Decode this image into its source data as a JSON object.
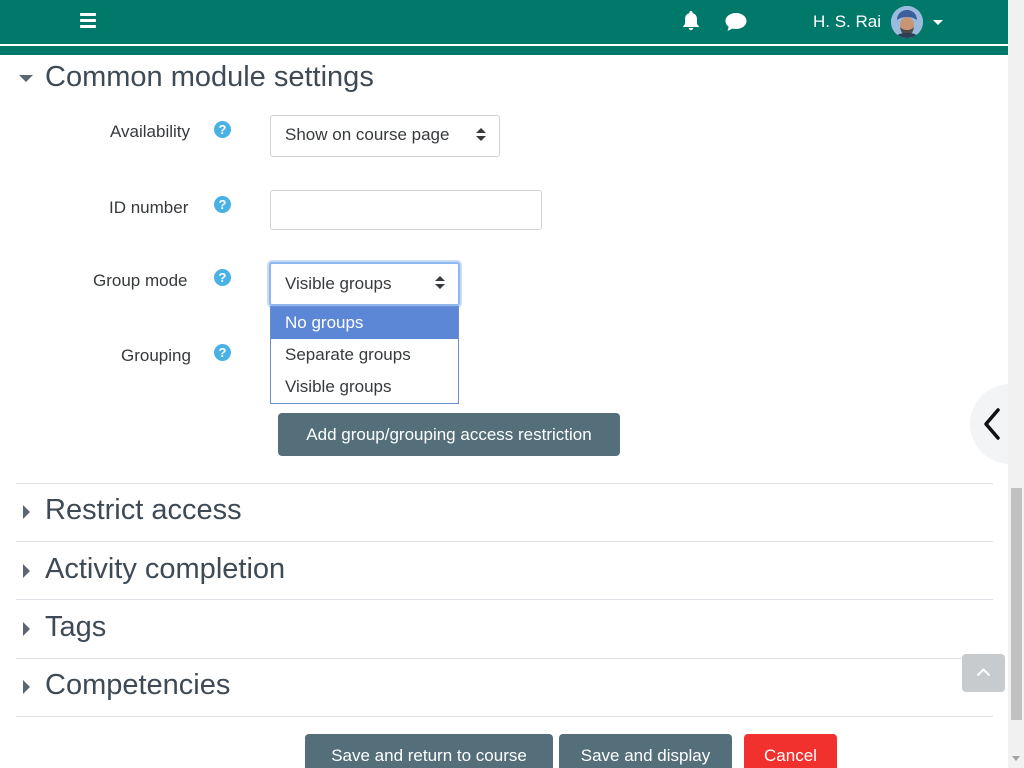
{
  "navbar": {
    "menu_icon": "hamburger-icon",
    "notifications_icon": "bell-icon",
    "messages_icon": "chat-bubble-icon",
    "user_name": "H. S. Rai",
    "user_caret_icon": "caret-down-icon",
    "color": "#00796b"
  },
  "section": {
    "title": "Common module settings",
    "fields": {
      "availability": {
        "label": "Availability",
        "value": "Show on course page"
      },
      "id_number": {
        "label": "ID number",
        "value": ""
      },
      "group_mode": {
        "label": "Group mode",
        "value": "Visible groups",
        "options": [
          "No groups",
          "Separate groups",
          "Visible groups"
        ],
        "highlighted": "No groups"
      },
      "grouping": {
        "label": "Grouping"
      }
    },
    "add_restriction_label": "Add group/grouping access restriction"
  },
  "collapsed_sections": [
    "Restrict access",
    "Activity completion",
    "Tags",
    "Competencies"
  ],
  "footer": {
    "save_return_label": "Save and return to course",
    "save_display_label": "Save and display",
    "cancel_label": "Cancel",
    "cancel_color": "#f0312e"
  },
  "help_icon": "?"
}
